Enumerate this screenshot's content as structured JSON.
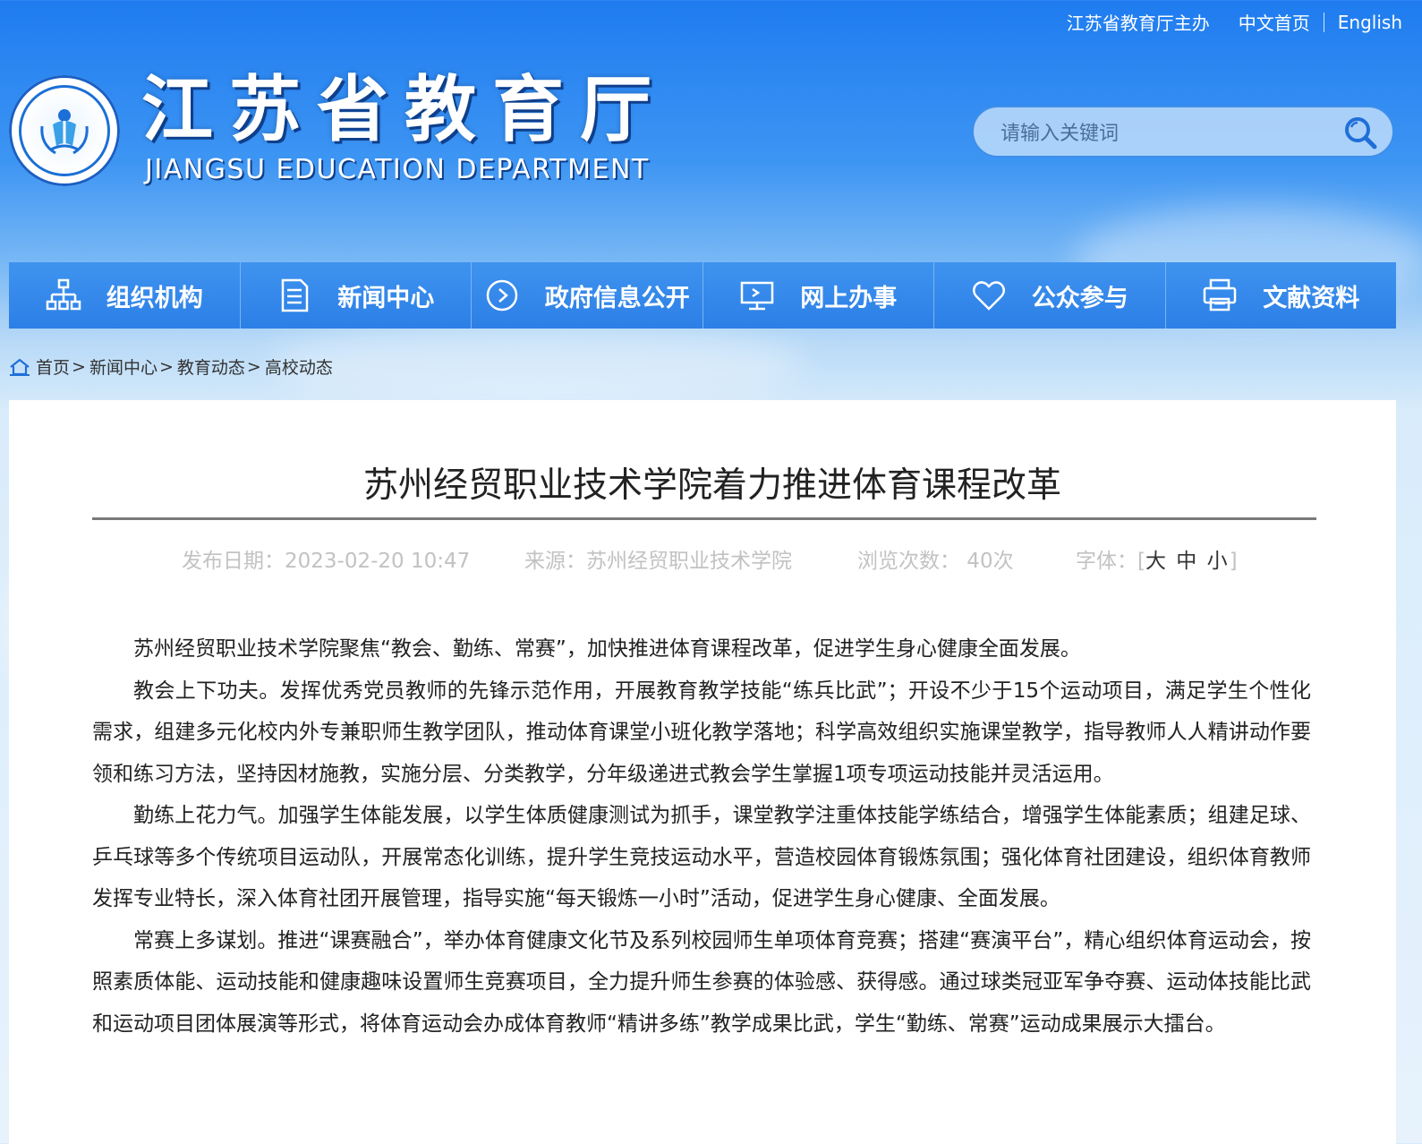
{
  "top_links": {
    "host": "江苏省教育厅主办",
    "chinese_home": "中文首页",
    "english": "English"
  },
  "logo": {
    "title": "江苏省教育厅",
    "subtitle": "JIANGSU EDUCATION DEPARTMENT"
  },
  "search": {
    "placeholder": "请输入关键词",
    "icon": "search-icon"
  },
  "nav": {
    "items": [
      {
        "label": "组织机构",
        "icon": "org-chart-icon"
      },
      {
        "label": "新闻中心",
        "icon": "document-icon"
      },
      {
        "label": "政府信息公开",
        "icon": "play-circle-icon"
      },
      {
        "label": "网上办事",
        "icon": "monitor-icon"
      },
      {
        "label": "公众参与",
        "icon": "heart-icon"
      },
      {
        "label": "文献资料",
        "icon": "printer-icon"
      }
    ]
  },
  "breadcrumb": {
    "icon": "home-icon",
    "items": [
      "首页",
      "新闻中心",
      "教育动态",
      "高校动态"
    ],
    "separator": ">"
  },
  "article": {
    "title": "苏州经贸职业技术学院着力推进体育课程改革",
    "publish_date": "发布日期：2023-02-20 10:47",
    "source": "来源：苏州经贸职业技术学院",
    "views": "浏览次数： 40次",
    "font_label": "字体：",
    "font_open": "[",
    "font_large": "大",
    "font_medium": "中",
    "font_small": "小",
    "font_close": "]",
    "paragraphs": [
      "苏州经贸职业技术学院聚焦“教会、勤练、常赛”，加快推进体育课程改革，促进学生身心健康全面发展。",
      "教会上下功夫。发挥优秀党员教师的先锋示范作用，开展教育教学技能“练兵比武”；开设不少于15个运动项目，满足学生个性化需求，组建多元化校内外专兼职师生教学团队，推动体育课堂小班化教学落地；科学高效组织实施课堂教学，指导教师人人精讲动作要领和练习方法，坚持因材施教，实施分层、分类教学，分年级递进式教会学生掌握1项专项运动技能并灵活运用。",
      "勤练上花力气。加强学生体能发展，以学生体质健康测试为抓手，课堂教学注重体技能学练结合，增强学生体能素质；组建足球、乒乓球等多个传统项目运动队，开展常态化训练，提升学生竞技运动水平，营造校园体育锻炼氛围；强化体育社团建设，组织体育教师发挥专业特长，深入体育社团开展管理，指导实施“每天锻炼一小时”活动，促进学生身心健康、全面发展。",
      "常赛上多谋划。推进“课赛融合”，举办体育健康文化节及系列校园师生单项体育竞赛；搭建“赛演平台”，精心组织体育运动会，按照素质体能、运动技能和健康趣味设置师生竞赛项目，全力提升师生参赛的体验感、获得感。通过球类冠亚军争夺赛、运动体技能比武和运动项目团体展演等形式，将体育运动会办成体育教师“精讲多练”教学成果比武，学生“勤练、常赛”运动成果展示大擂台。"
    ]
  },
  "colors": {
    "header_blue": "#1f7cf0",
    "nav_blue": "#2c7fe6",
    "meta_gray": "#c2c2c2",
    "text": "#222222"
  }
}
